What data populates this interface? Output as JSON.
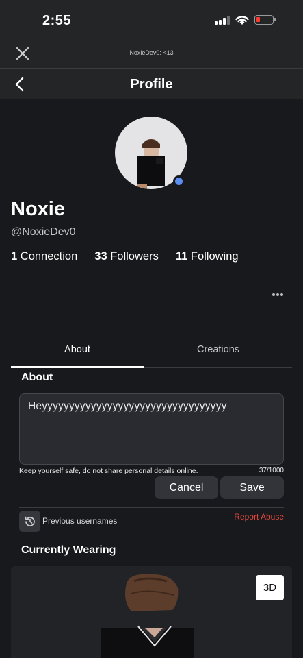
{
  "status": {
    "time": "2:55"
  },
  "browser": {
    "url": "NoxieDev0: <13"
  },
  "nav": {
    "title": "Profile"
  },
  "profile": {
    "display_name": "Noxie",
    "username": "@NoxieDev0",
    "presence_color": "#5b8ef0",
    "stats": {
      "connections_count": "1",
      "connections_label": "Connection",
      "followers_count": "33",
      "followers_label": "Followers",
      "following_count": "11",
      "following_label": "Following"
    }
  },
  "tabs": [
    {
      "label": "About",
      "selected": true
    },
    {
      "label": "Creations",
      "selected": false
    }
  ],
  "about": {
    "heading": "About",
    "bio_value": "Heyyyyyyyyyyyyyyyyyyyyyyyyyyyyyyyyyy",
    "safety_note": "Keep yourself safe, do not share personal details online.",
    "char_count": "37/1000",
    "cancel_label": "Cancel",
    "save_label": "Save",
    "previous_usernames_label": "Previous usernames",
    "report_label": "Report Abuse"
  },
  "wearing": {
    "heading": "Currently Wearing",
    "view_3d_label": "3D"
  },
  "colors": {
    "background": "#18191d",
    "accent_red": "#e8483c",
    "battery_low": "#ff3b30"
  }
}
